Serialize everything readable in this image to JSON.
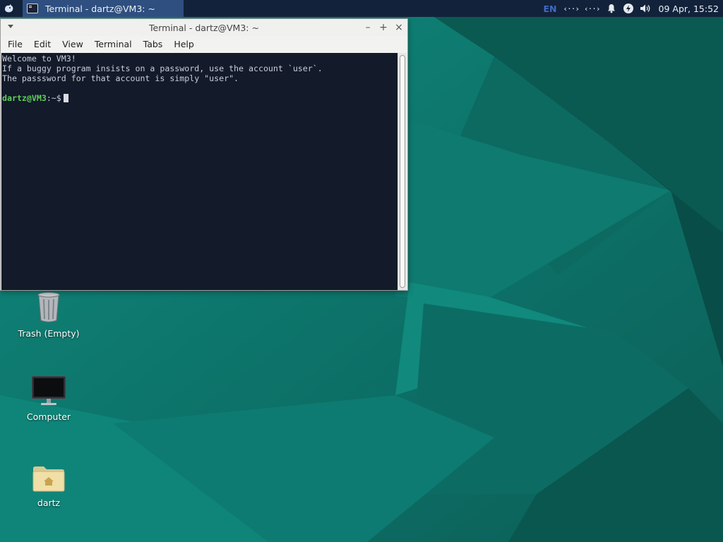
{
  "panel": {
    "task_title": "Terminal - dartz@VM3: ~",
    "keyboard_layout": "EN",
    "network_1": "‹··›",
    "network_2": "‹··›",
    "clock": "09 Apr, 15:52"
  },
  "terminal": {
    "title": "Terminal - dartz@VM3: ~",
    "menu": [
      "File",
      "Edit",
      "View",
      "Terminal",
      "Tabs",
      "Help"
    ],
    "lines": [
      "Welcome to VM3!",
      "If a buggy program insists on a password, use the account `user`.",
      "The passsword for that account is simply \"user\".",
      ""
    ],
    "prompt_user": "dartz@VM3",
    "prompt_path": ":~$"
  },
  "desktop": {
    "icons": [
      {
        "label": "Trash (Empty)",
        "icon": "trash-icon"
      },
      {
        "label": "Computer",
        "icon": "monitor-icon"
      },
      {
        "label": "dartz",
        "icon": "home-folder-icon"
      }
    ]
  },
  "colors": {
    "panel_bg": "#12223b",
    "task_active_bg": "#2e4f7f",
    "terminal_bg": "#131a2a",
    "prompt_green": "#5ed05a",
    "wallpaper_teal": "#0e7a70"
  }
}
